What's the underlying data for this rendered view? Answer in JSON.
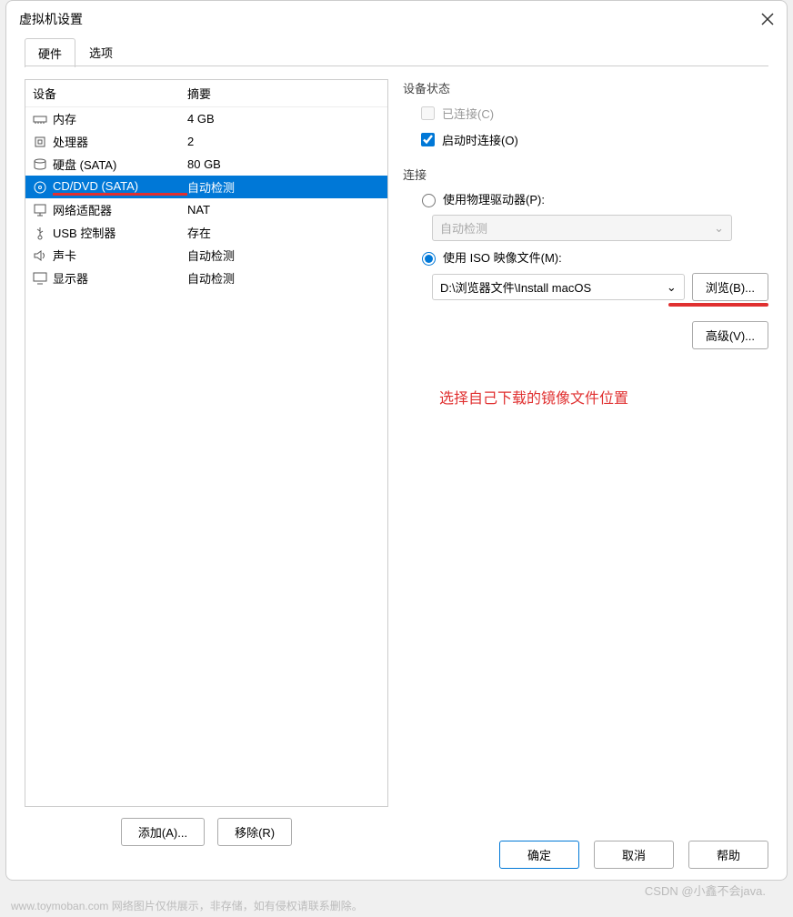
{
  "window": {
    "title": "虚拟机设置"
  },
  "tabs": {
    "hardware": "硬件",
    "options": "选项"
  },
  "deviceList": {
    "header": {
      "device": "设备",
      "summary": "摘要"
    },
    "items": [
      {
        "name": "内存",
        "summary": "4 GB",
        "icon": "memory"
      },
      {
        "name": "处理器",
        "summary": "2",
        "icon": "cpu"
      },
      {
        "name": "硬盘 (SATA)",
        "summary": "80 GB",
        "icon": "disk"
      },
      {
        "name": "CD/DVD (SATA)",
        "summary": "自动检测",
        "icon": "cd",
        "selected": true
      },
      {
        "name": "网络适配器",
        "summary": "NAT",
        "icon": "net"
      },
      {
        "name": "USB 控制器",
        "summary": "存在",
        "icon": "usb"
      },
      {
        "name": "声卡",
        "summary": "自动检测",
        "icon": "sound"
      },
      {
        "name": "显示器",
        "summary": "自动检测",
        "icon": "display"
      }
    ]
  },
  "leftButtons": {
    "add": "添加(A)...",
    "remove": "移除(R)"
  },
  "deviceStatus": {
    "title": "设备状态",
    "connected": "已连接(C)",
    "connectOnStart": "启动时连接(O)"
  },
  "connection": {
    "title": "连接",
    "physical": "使用物理驱动器(P):",
    "physicalValue": "自动检测",
    "iso": "使用 ISO 映像文件(M):",
    "isoValue": "D:\\浏览器文件\\Install macOS ",
    "browse": "浏览(B)..."
  },
  "advanced": "高级(V)...",
  "note": "选择自己下载的镜像文件位置",
  "footer": {
    "ok": "确定",
    "cancel": "取消",
    "help": "帮助"
  },
  "watermark1": "www.toymoban.com 网络图片仅供展示，非存储，如有侵权请联系删除。",
  "watermark2": "CSDN @小鑫不会java."
}
